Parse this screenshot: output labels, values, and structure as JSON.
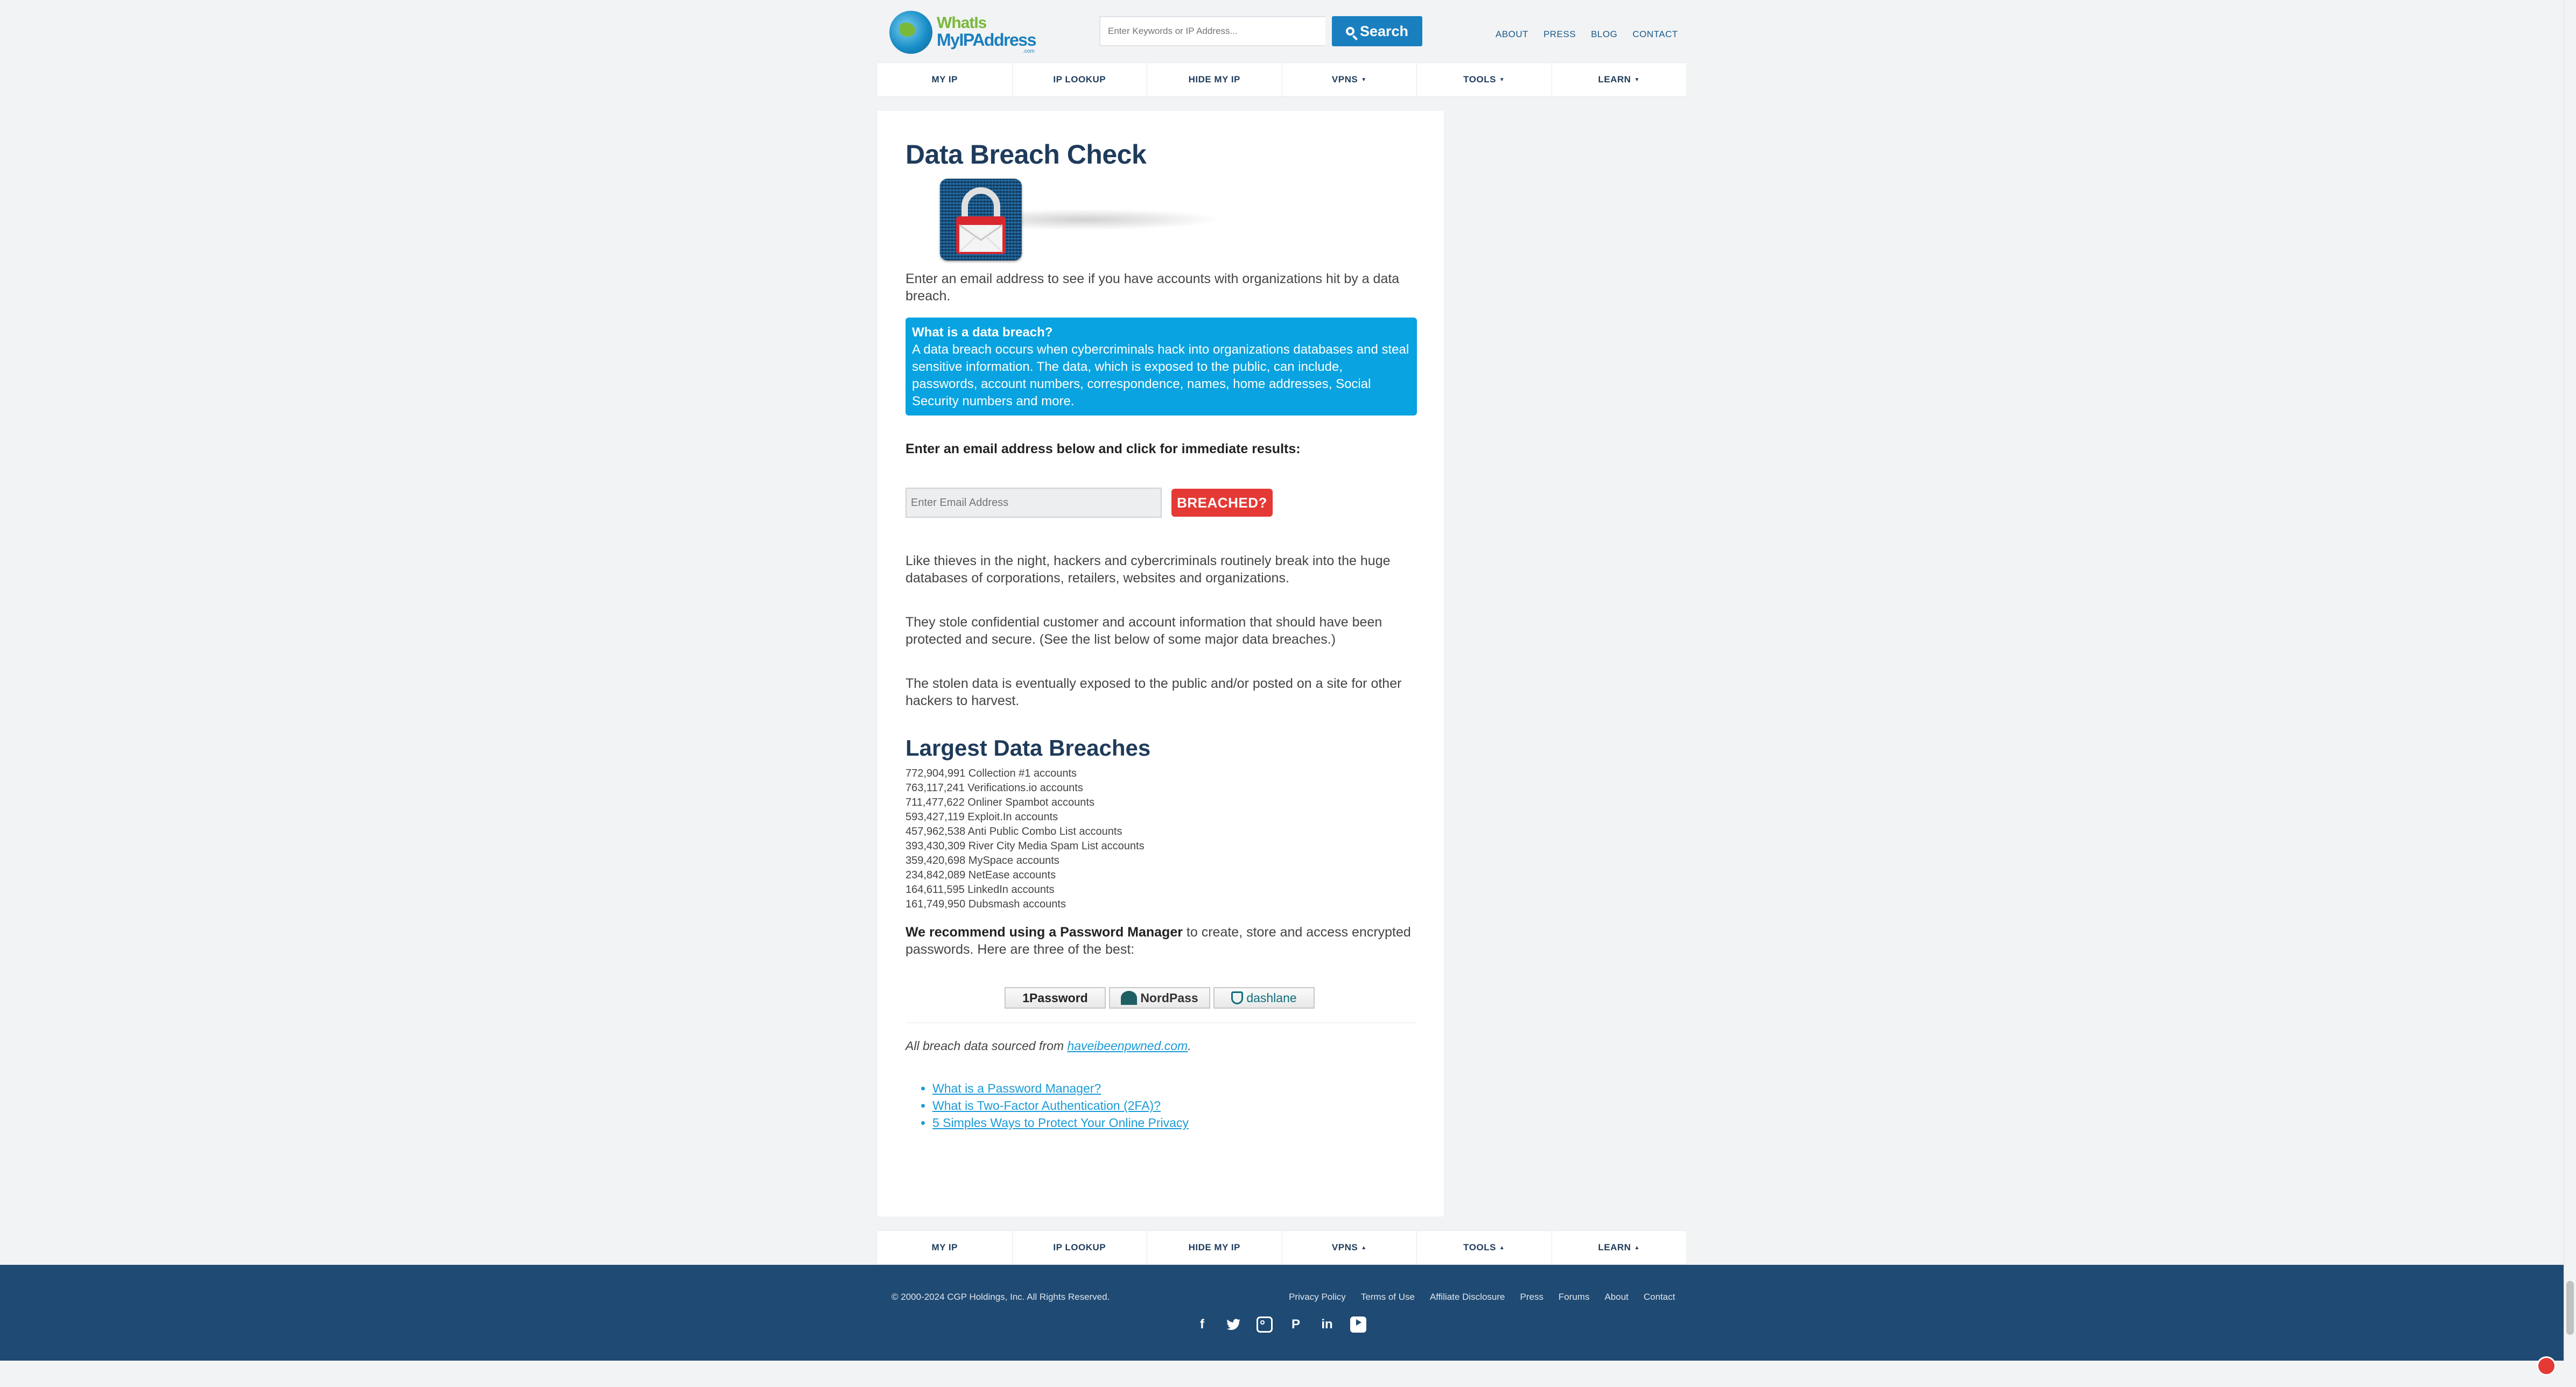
{
  "header": {
    "logo": {
      "line1": "WhatIs",
      "line2": "MyIPAddress",
      "line3": ".com"
    },
    "search_placeholder": "Enter Keywords or IP Address...",
    "search_button": "Search",
    "top_links": [
      "ABOUT",
      "PRESS",
      "BLOG",
      "CONTACT"
    ]
  },
  "nav": {
    "items": [
      {
        "label": "MY IP",
        "caret": ""
      },
      {
        "label": "IP LOOKUP",
        "caret": ""
      },
      {
        "label": "HIDE MY IP",
        "caret": ""
      },
      {
        "label": "VPNS",
        "caret": "▼"
      },
      {
        "label": "TOOLS",
        "caret": "▼"
      },
      {
        "label": "LEARN",
        "caret": "▼"
      }
    ],
    "footer_caret": "▲"
  },
  "main": {
    "title": "Data Breach Check",
    "intro": "Enter an email address to see if you have accounts with organizations hit by a data breach.",
    "infobox": {
      "title": "What is a data breach?",
      "body": "A data breach occurs when cybercriminals hack into organizations databases and steal sensitive information. The data, which is exposed to the public, can include, passwords, account numbers, correspondence, names, home addresses, Social Security numbers and more."
    },
    "cta": "Enter an email address below and click for immediate results:",
    "email_placeholder": "Enter Email Address",
    "breached_button": "BREACHED?",
    "paragraphs": [
      "Like thieves in the night, hackers and cybercriminals routinely break into the huge databases of corporations, retailers, websites and organizations.",
      "They stole confidential customer and account information that should have been protected and secure. (See the list below of some major data breaches.)",
      "The stolen data is eventually exposed to the public and/or posted on a site for other hackers to harvest."
    ],
    "largest_title": "Largest Data Breaches",
    "breaches": [
      "772,904,991 Collection #1 accounts",
      "763,117,241 Verifications.io accounts",
      "711,477,622 Onliner Spambot accounts",
      "593,427,119 Exploit.In accounts",
      "457,962,538 Anti Public Combo List accounts",
      "393,430,309 River City Media Spam List accounts",
      "359,420,698 MySpace accounts",
      "234,842,089 NetEase accounts",
      "164,611,595 LinkedIn accounts",
      "161,749,950 Dubsmash accounts"
    ],
    "recommend_bold": "We recommend using a Password Manager",
    "recommend_rest": " to create, store and access encrypted passwords. Here are three of the best:",
    "password_managers": [
      "1Password",
      "NordPass",
      "dashlane"
    ],
    "source_prefix": "All breach data sourced from ",
    "source_link": "haveibeenpwned.com",
    "source_suffix": ".",
    "related_links": [
      "What is a Password Manager?",
      "What is Two-Factor Authentication (2FA)?",
      "5 Simples Ways to Protect Your Online Privacy"
    ]
  },
  "footer": {
    "copyright": "© 2000-2024 CGP Holdings, Inc. All Rights Reserved.",
    "links": [
      "Privacy Policy",
      "Terms of Use",
      "Affiliate Disclosure",
      "Press",
      "Forums",
      "About",
      "Contact"
    ],
    "social_icons": [
      "facebook-icon",
      "twitter-icon",
      "instagram-icon",
      "pinterest-icon",
      "linkedin-icon",
      "youtube-icon"
    ]
  },
  "colors": {
    "brand_blue": "#1a7fbf",
    "navy": "#1f3b5b",
    "info_box": "#08a3e0",
    "breach_red": "#e53935",
    "footer_bg": "#1f4a73"
  }
}
